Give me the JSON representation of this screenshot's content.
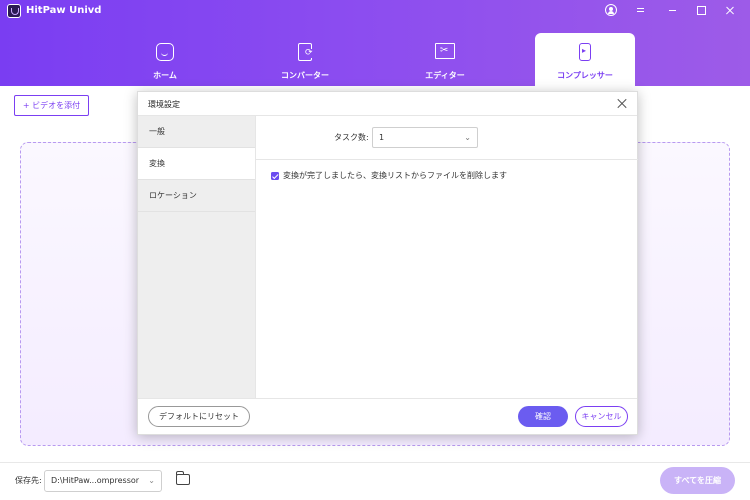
{
  "app": {
    "title": "HitPaw Univd"
  },
  "nav": {
    "tabs": [
      {
        "label": "ホーム",
        "icon": "home-icon"
      },
      {
        "label": "コンバーター",
        "icon": "converter-icon"
      },
      {
        "label": "エディター",
        "icon": "editor-icon"
      },
      {
        "label": "コンプレッサー",
        "icon": "compressor-icon",
        "active": true
      }
    ]
  },
  "toolbar": {
    "add_video_label": "+ ビデオを添付"
  },
  "bottom": {
    "save_label": "保存先:",
    "save_path": "D:\\HitPaw...ompressor",
    "compress_all_label": "すべてを圧縮"
  },
  "dialog": {
    "title": "環境設定",
    "sidebar": [
      {
        "label": "一般"
      },
      {
        "label": "変換",
        "active": true
      },
      {
        "label": "ロケーション"
      }
    ],
    "task_label": "タスク数:",
    "task_value": "1",
    "checkbox_label": "変換が完了しましたら、変換リストからファイルを削除します",
    "checkbox_checked": true,
    "reset_label": "デフォルトにリセット",
    "ok_label": "確認",
    "cancel_label": "キャンセル"
  },
  "colors": {
    "brand_purple": "#7b3ff2",
    "accent_button": "#6b5cf0"
  }
}
